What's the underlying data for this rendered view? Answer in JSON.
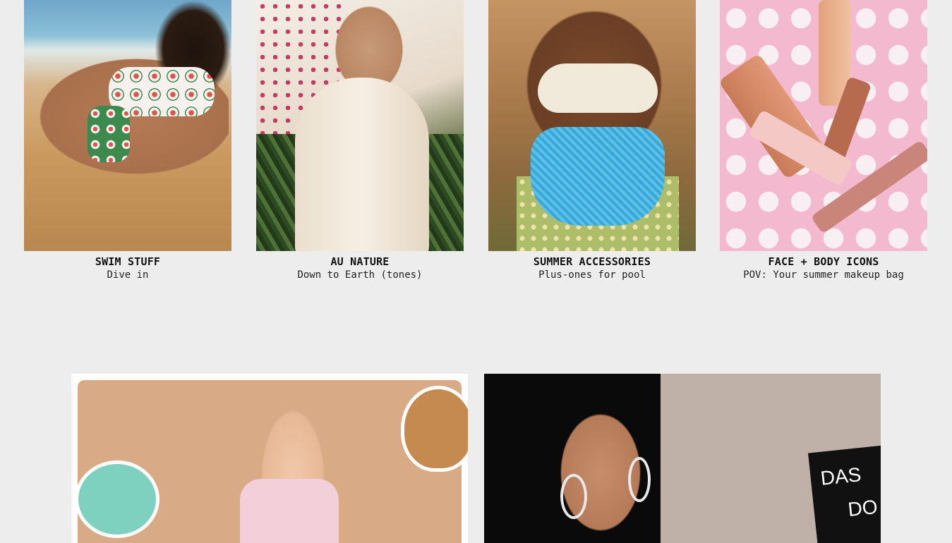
{
  "categories": [
    {
      "title": "SWIM STUFF",
      "subtitle": "Dive in",
      "image": "swimwear-photo"
    },
    {
      "title": "AU NATURE",
      "subtitle": "Down to Earth (tones)",
      "image": "neutral-dress-photo"
    },
    {
      "title": "SUMMER ACCESSORIES",
      "subtitle": "Plus-ones for pool",
      "image": "accessories-photo"
    },
    {
      "title": "FACE + BODY ICONS",
      "subtitle": "POV: Your summer makeup bag",
      "image": "makeup-photo"
    }
  ],
  "banners": [
    {
      "image": "pokemon-collab-photo"
    },
    {
      "image": "das-sign-photo",
      "sign_text_1": "DAS",
      "sign_text_2": "DO"
    }
  ]
}
